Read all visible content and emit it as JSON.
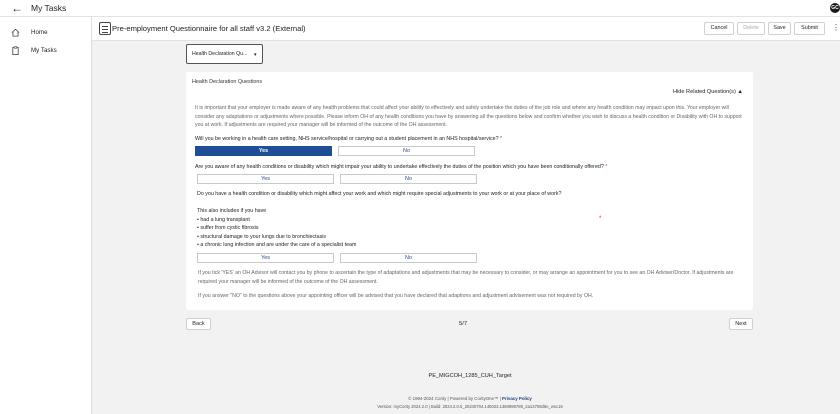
{
  "app": {
    "title": "My Tasks",
    "avatar_initials": "GC"
  },
  "sidebar": {
    "items": [
      {
        "label": "Home",
        "icon": "home-icon"
      },
      {
        "label": "My Tasks",
        "icon": "clipboard-icon"
      }
    ]
  },
  "header": {
    "form_title": "Pre-employment Questionnaire for all staff v3.2 (External)",
    "cancel_label": "Cancel",
    "delete_label": "Delete",
    "save_label": "Save",
    "submit_label": "Submit"
  },
  "section_select": {
    "value": "Health Declaration Qu..."
  },
  "card": {
    "title": "Health Declaration Questions",
    "hide_related": "Hide Related Question(s)",
    "intro": "It is important that your employer is made aware of any health problems that could affect your ability to effectively and safely undertake the duties of the job role and where any health condition may impact upon this. Your employer will consider any adaptations or adjustments where possible. Please inform OH of any health conditions you have by answering all the questions below and confirm whether you wish to discuss a health condition or Disability with OH to support you at work. If adjustments are required your manager will be informed of the outcome of the OH assessment.",
    "q1": "Will you be working in a health care setting, NHS service/hospital or carrying out a student placement in an NHS hospital/service?",
    "q2": "Are you aware of any health conditions or disability which might impair your ability to undertake effectively the duties of the position which you have been conditionally offered?",
    "q3": "Do you have a health condition or disability which might affect your work and which might require special adjustments to your work or at your place of work?",
    "also_heading": "This also includes if you have",
    "also_items": [
      "• had a lung transplant",
      "• suffer from cystic fibrosis",
      "• structural damage to your lungs due to bronchiectasis",
      "• a chronic lung infection and are under the care of a specialist team"
    ],
    "required_mark": "*",
    "yes_label": "Yes",
    "no_label": "No",
    "note1": "If you tick 'YES' an OH Advisor will contact you by phone to ascertain the type of adaptations and adjustments that may be necessary to consider, or may arrange an appointment for you to see an OH Adviser/Doctor. If adjustments are required your manager will be informed of the outcome of the OH assessment.",
    "note2": "If you answer \"NO\" to the questions above your appointing officer will be advised that you have declared that adaptions and adjustment advisement was not required by OH."
  },
  "nav": {
    "back_label": "Back",
    "next_label": "Next",
    "page_indicator": "5/7"
  },
  "footer": {
    "target": "PE_MIGCOH_1285_CUH_Target",
    "copyright": "© 1994-2024 Cority | Powered by CorityOne™ |",
    "privacy": "Privacy Policy",
    "version": "Version: myCority 2024.2.0 | Build: 2024.2.0.5_20240704.145023.1360896789_2a13708d6e_wsc19"
  },
  "colors": {
    "selected_button": "#1f4e97",
    "required": "#dd2222"
  }
}
